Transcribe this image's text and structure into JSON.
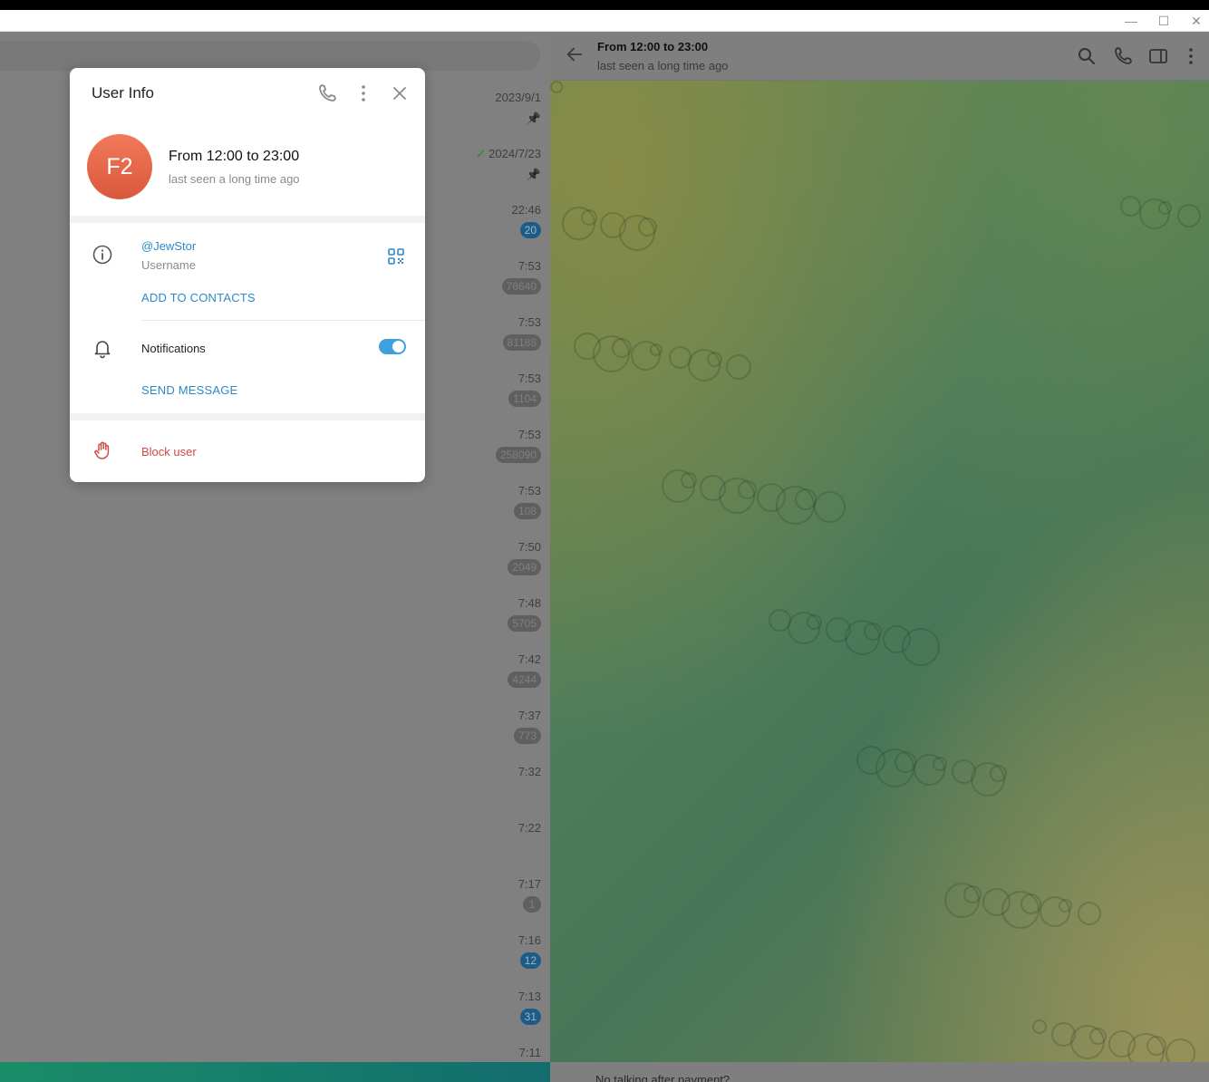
{
  "window": {
    "minimize_icon": "minimize-icon",
    "maximize_icon": "maximize-icon",
    "close_icon": "close-icon"
  },
  "chat_list": {
    "items": [
      {
        "time": "2023/9/1",
        "pinned": true,
        "badge": ""
      },
      {
        "time": "2024/7/23",
        "check": true,
        "pinned": true,
        "badge": ""
      },
      {
        "time": "22:46",
        "badge": "20",
        "badge_style": "blue"
      },
      {
        "time": "7:53",
        "badge": "76640"
      },
      {
        "time": "7:53",
        "badge": "81188"
      },
      {
        "time": "7:53",
        "badge": "1104"
      },
      {
        "time": "7:53",
        "badge": "258090"
      },
      {
        "time": "7:53",
        "badge": "108"
      },
      {
        "time": "7:50",
        "badge": "2049"
      },
      {
        "time": "7:48",
        "badge": "5705"
      },
      {
        "time": "7:42",
        "badge": "4244"
      },
      {
        "time": "7:37",
        "badge": "773"
      },
      {
        "time": "7:32",
        "badge": ""
      },
      {
        "time": "7:22",
        "badge": ""
      },
      {
        "time": "7:17",
        "badge": "1"
      },
      {
        "time": "7:16",
        "badge": "12",
        "badge_style": "blue"
      },
      {
        "time": "7:13",
        "badge": "31",
        "badge_style": "blue"
      },
      {
        "time": "7:11",
        "badge": ""
      }
    ]
  },
  "chat_header": {
    "title": "From 12:00 to 23:00",
    "status": "last seen a long time ago"
  },
  "composer": {
    "text": "No talking after payment?"
  },
  "user_info": {
    "title": "User Info",
    "avatar_initials": "F2",
    "avatar_color": "#e8674a",
    "name": "From 12:00 to 23:00",
    "status": "last seen a long time ago",
    "username": "@JewStor",
    "username_label": "Username",
    "add_to_contacts": "ADD TO CONTACTS",
    "notifications_label": "Notifications",
    "notifications_on": true,
    "send_message": "SEND MESSAGE",
    "block_user": "Block user"
  },
  "colors": {
    "accent": "#2d89c8",
    "danger": "#d04a44",
    "toggle": "#3ea0dc"
  }
}
